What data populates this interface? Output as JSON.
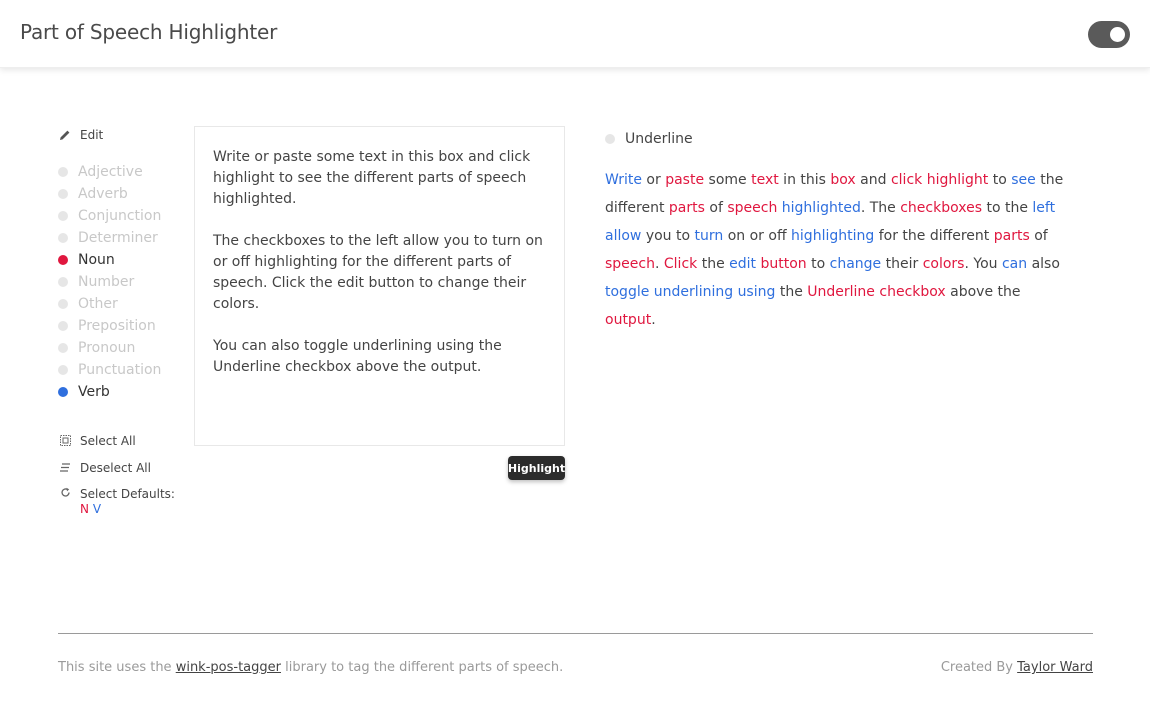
{
  "header": {
    "title": "Part of Speech Highlighter",
    "toggle_state": "on"
  },
  "sidebar": {
    "edit_label": "Edit",
    "items": [
      {
        "label": "Adjective",
        "enabled": false,
        "color": "#e6e6e6"
      },
      {
        "label": "Adverb",
        "enabled": false,
        "color": "#e6e6e6"
      },
      {
        "label": "Conjunction",
        "enabled": false,
        "color": "#e6e6e6"
      },
      {
        "label": "Determiner",
        "enabled": false,
        "color": "#e6e6e6"
      },
      {
        "label": "Noun",
        "enabled": true,
        "color": "#e0173f"
      },
      {
        "label": "Number",
        "enabled": false,
        "color": "#e6e6e6"
      },
      {
        "label": "Other",
        "enabled": false,
        "color": "#e6e6e6"
      },
      {
        "label": "Preposition",
        "enabled": false,
        "color": "#e6e6e6"
      },
      {
        "label": "Pronoun",
        "enabled": false,
        "color": "#e6e6e6"
      },
      {
        "label": "Punctuation",
        "enabled": false,
        "color": "#e6e6e6"
      },
      {
        "label": "Verb",
        "enabled": true,
        "color": "#2f6fde"
      }
    ],
    "select_all_label": "Select All",
    "deselect_all_label": "Deselect All",
    "select_defaults_label": "Select Defaults:",
    "defaults_n": "N",
    "defaults_v": "V"
  },
  "input": {
    "paragraphs": [
      "Write or paste some text in this box and click highlight to see the different parts of speech highlighted.",
      "The checkboxes to the left allow you to turn on or off highlighting for the different parts of speech. Click the edit button to change their colors.",
      "You can also toggle underlining using the Underline checkbox above the output."
    ],
    "highlight_button": "Highlight"
  },
  "output": {
    "underline_label": "Underline",
    "underline_checked": false,
    "tokens": [
      {
        "t": "Write",
        "p": "verb"
      },
      {
        "t": " or ",
        "p": ""
      },
      {
        "t": "paste",
        "p": "noun"
      },
      {
        "t": " some ",
        "p": ""
      },
      {
        "t": "text",
        "p": "noun"
      },
      {
        "t": " in this ",
        "p": ""
      },
      {
        "t": "box",
        "p": "noun"
      },
      {
        "t": " and ",
        "p": ""
      },
      {
        "t": "click",
        "p": "noun"
      },
      {
        "t": " ",
        "p": ""
      },
      {
        "t": "highlight",
        "p": "noun"
      },
      {
        "t": " to ",
        "p": ""
      },
      {
        "t": "see",
        "p": "verb"
      },
      {
        "t": " the different ",
        "p": ""
      },
      {
        "t": "parts",
        "p": "noun"
      },
      {
        "t": " of ",
        "p": ""
      },
      {
        "t": "speech",
        "p": "noun"
      },
      {
        "t": " ",
        "p": ""
      },
      {
        "t": "highlighted",
        "p": "verb"
      },
      {
        "t": ". The ",
        "p": ""
      },
      {
        "t": "checkboxes",
        "p": "noun"
      },
      {
        "t": " to the ",
        "p": ""
      },
      {
        "t": "left",
        "p": "verb"
      },
      {
        "t": " ",
        "p": ""
      },
      {
        "t": "allow",
        "p": "verb"
      },
      {
        "t": " you to ",
        "p": ""
      },
      {
        "t": "turn",
        "p": "verb"
      },
      {
        "t": " on or off ",
        "p": ""
      },
      {
        "t": "highlighting",
        "p": "verb"
      },
      {
        "t": " for the different ",
        "p": ""
      },
      {
        "t": "parts",
        "p": "noun"
      },
      {
        "t": " of ",
        "p": ""
      },
      {
        "t": "speech",
        "p": "noun"
      },
      {
        "t": ". ",
        "p": ""
      },
      {
        "t": "Click",
        "p": "noun"
      },
      {
        "t": " the ",
        "p": ""
      },
      {
        "t": "edit",
        "p": "verb"
      },
      {
        "t": " ",
        "p": ""
      },
      {
        "t": "button",
        "p": "noun"
      },
      {
        "t": " to ",
        "p": ""
      },
      {
        "t": "change",
        "p": "verb"
      },
      {
        "t": " their ",
        "p": ""
      },
      {
        "t": "colors",
        "p": "noun"
      },
      {
        "t": ". You ",
        "p": ""
      },
      {
        "t": "can",
        "p": "verb"
      },
      {
        "t": " also ",
        "p": ""
      },
      {
        "t": "toggle",
        "p": "verb"
      },
      {
        "t": " ",
        "p": ""
      },
      {
        "t": "underlining",
        "p": "verb"
      },
      {
        "t": " ",
        "p": ""
      },
      {
        "t": "using",
        "p": "verb"
      },
      {
        "t": " the ",
        "p": ""
      },
      {
        "t": "Underline",
        "p": "noun"
      },
      {
        "t": " ",
        "p": ""
      },
      {
        "t": "checkbox",
        "p": "noun"
      },
      {
        "t": " above the ",
        "p": ""
      },
      {
        "t": "output",
        "p": "noun"
      },
      {
        "t": ".",
        "p": ""
      }
    ]
  },
  "footer": {
    "left_prefix": "This site uses the ",
    "left_link": "wink-pos-tagger",
    "left_suffix": " library to tag the different parts of speech.",
    "right_prefix": "Created By ",
    "right_link": "Taylor Ward"
  },
  "colors": {
    "noun": "#e0173f",
    "verb": "#2f6fde"
  }
}
